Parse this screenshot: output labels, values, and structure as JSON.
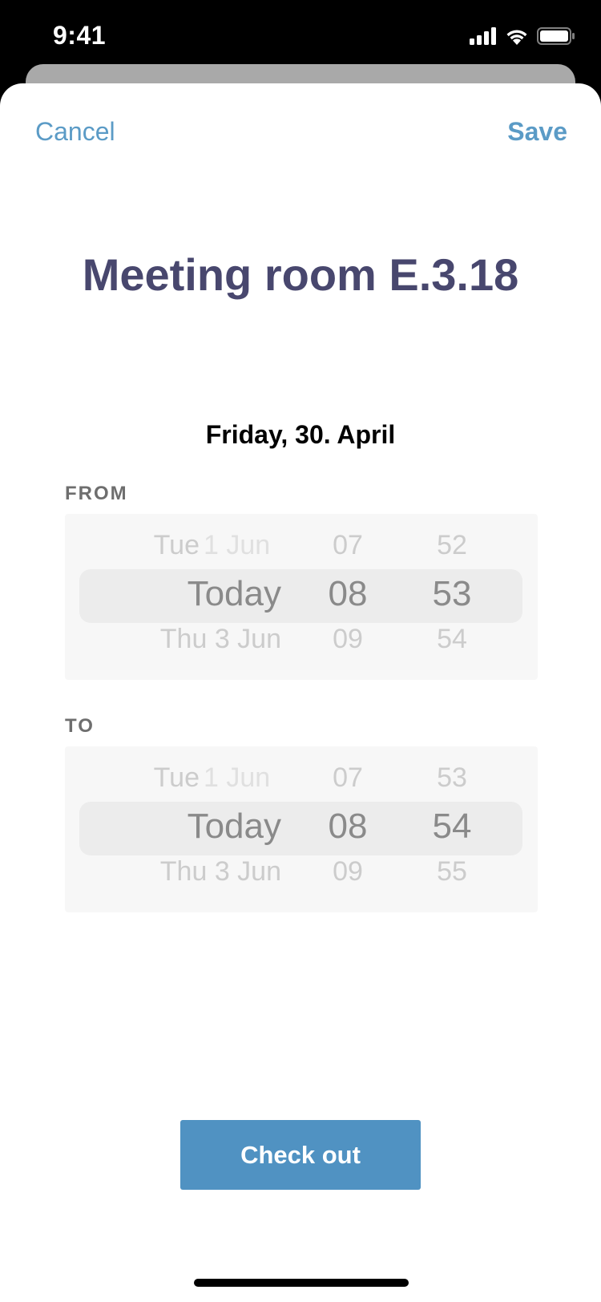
{
  "status_bar": {
    "time": "9:41"
  },
  "nav": {
    "cancel_label": "Cancel",
    "save_label": "Save"
  },
  "title": "Meeting room E.3.18",
  "date": "Friday, 30. April",
  "from": {
    "label": "FROM",
    "prev": {
      "day_name": "Tue",
      "day_date": "1 Jun",
      "hour": "07",
      "minute": "52"
    },
    "selected": {
      "day": "Today",
      "hour": "08",
      "minute": "53"
    },
    "next": {
      "day": "Thu 3 Jun",
      "hour": "09",
      "minute": "54"
    }
  },
  "to": {
    "label": "TO",
    "prev": {
      "day_name": "Tue",
      "day_date": "1 Jun",
      "hour": "07",
      "minute": "53"
    },
    "selected": {
      "day": "Today",
      "hour": "08",
      "minute": "54"
    },
    "next": {
      "day": "Thu 3 Jun",
      "hour": "09",
      "minute": "55"
    }
  },
  "checkout_label": "Check out",
  "colors": {
    "accent": "#5b9bc6",
    "button": "#5092c2",
    "title": "#48476e"
  }
}
